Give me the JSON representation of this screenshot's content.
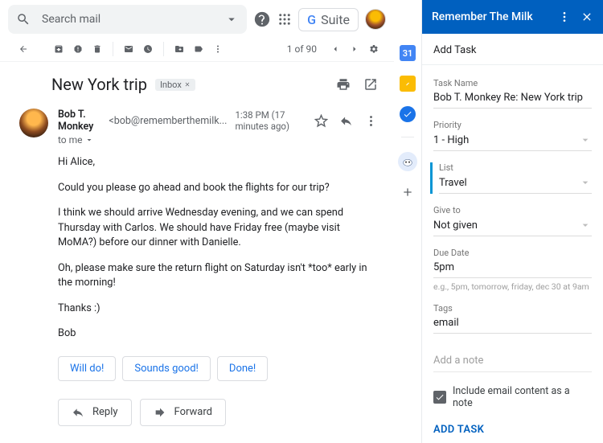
{
  "header": {
    "search_placeholder": "Search mail",
    "brand_g": "G",
    "brand_suite": "Suite"
  },
  "toolbar": {
    "page_count": "1 of 90"
  },
  "message": {
    "subject": "New York trip",
    "inbox_label": "Inbox",
    "sender_name": "Bob T. Monkey",
    "sender_email": "<bob@rememberthemilk...",
    "sent_time": "1:38 PM (17 minutes ago)",
    "to_line": "to me",
    "body": {
      "greeting": "Hi Alice,",
      "p1": "Could you please go ahead and book the flights for our trip?",
      "p2": "I think we should arrive Wednesday evening, and we can spend Thursday with Carlos. We should have Friday free (maybe visit MoMA?) before our dinner with Danielle.",
      "p3": "Oh, please make sure the return flight on Saturday isn't *too* early in the morning!",
      "signoff": "Thanks :)",
      "sig": "Bob"
    }
  },
  "smart_replies": [
    "Will do!",
    "Sounds good!",
    "Done!"
  ],
  "reply": {
    "reply_label": "Reply",
    "forward_label": "Forward"
  },
  "rail": {
    "calendar_day": "31"
  },
  "rtm": {
    "title": "Remember The Milk",
    "section": "Add Task",
    "task_name_label": "Task Name",
    "task_name_value": "Bob T. Monkey Re: New York trip",
    "priority_label": "Priority",
    "priority_value": "1 - High",
    "list_label": "List",
    "list_value": "Travel",
    "give_label": "Give to",
    "give_value": "Not given",
    "due_label": "Due Date",
    "due_value": "5pm",
    "due_hint": "e.g., 5pm, tomorrow, friday, dec 30 at 9am",
    "tags_label": "Tags",
    "tags_value": "email",
    "note_placeholder": "Add a note",
    "include_note_label": "Include email content as a note",
    "add_button": "ADD TASK"
  }
}
